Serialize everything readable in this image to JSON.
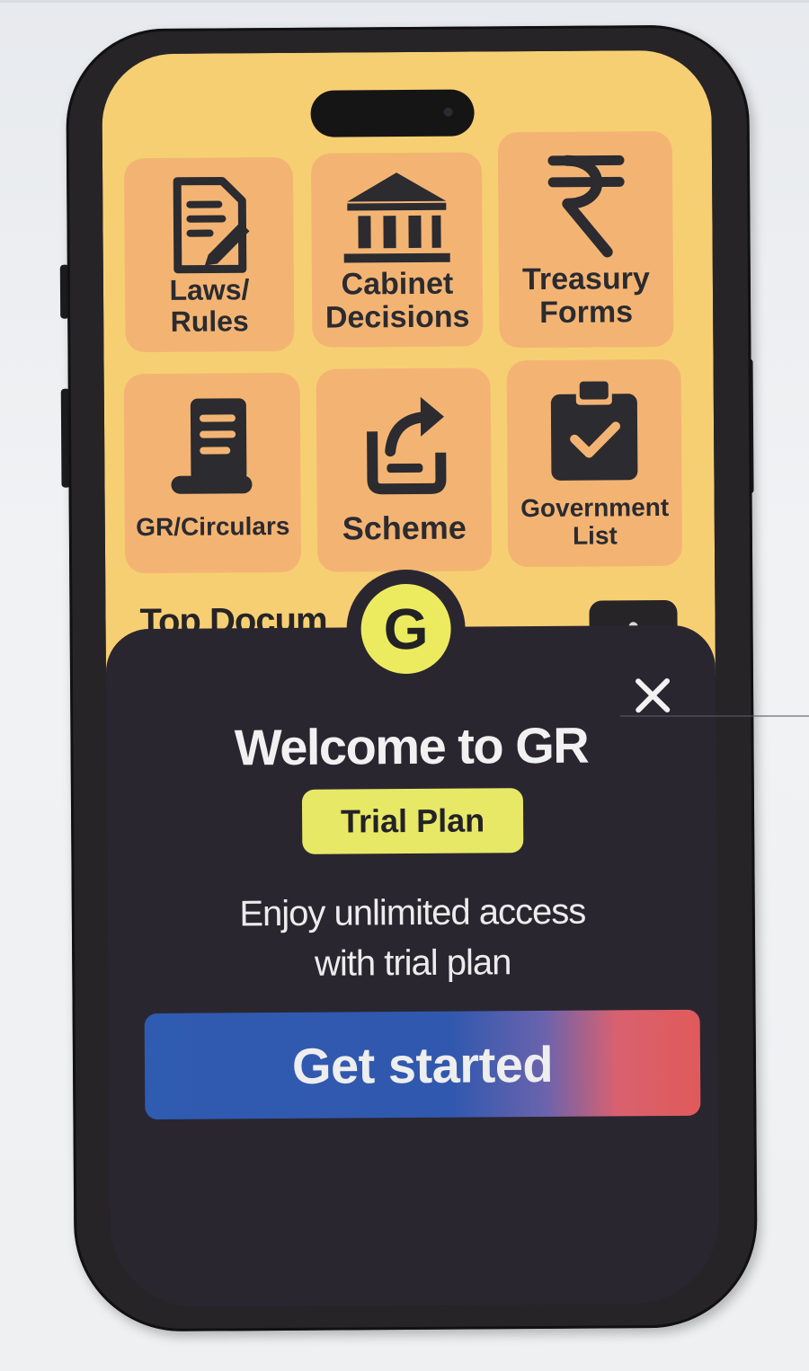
{
  "home": {
    "tiles": [
      {
        "label_line1": "Laws/",
        "label_line2": "Rules",
        "icon": "document-edit-icon"
      },
      {
        "label_line1": "Cabinet",
        "label_line2": "Decisions",
        "icon": "government-building-icon"
      },
      {
        "label_line1": "Treasury",
        "label_line2": "Forms",
        "icon": "rupee-icon"
      },
      {
        "label_line1": "GR/Circulars",
        "label_line2": "",
        "icon": "scroll-list-icon"
      },
      {
        "label_line1": "Scheme",
        "label_line2": "",
        "icon": "share-export-icon"
      },
      {
        "label_line1": "Government",
        "label_line2": "List",
        "icon": "clipboard-check-icon"
      }
    ],
    "section_title": "Top Docum"
  },
  "modal": {
    "logo_letter": "G",
    "close_symbol": "✕",
    "title": "Welcome to GR",
    "plan_badge": "Trial Plan",
    "description_line1": "Enjoy unlimited access",
    "description_line2": "with trial plan",
    "cta_label": "Get started"
  },
  "colors": {
    "home_background": "#f7cf73",
    "tile_background": "#f3b473",
    "sheet_background": "#2a2630",
    "badge_yellow": "#e8e867",
    "cta_blue": "#2f5bb0",
    "cta_red": "#e05a5a"
  }
}
